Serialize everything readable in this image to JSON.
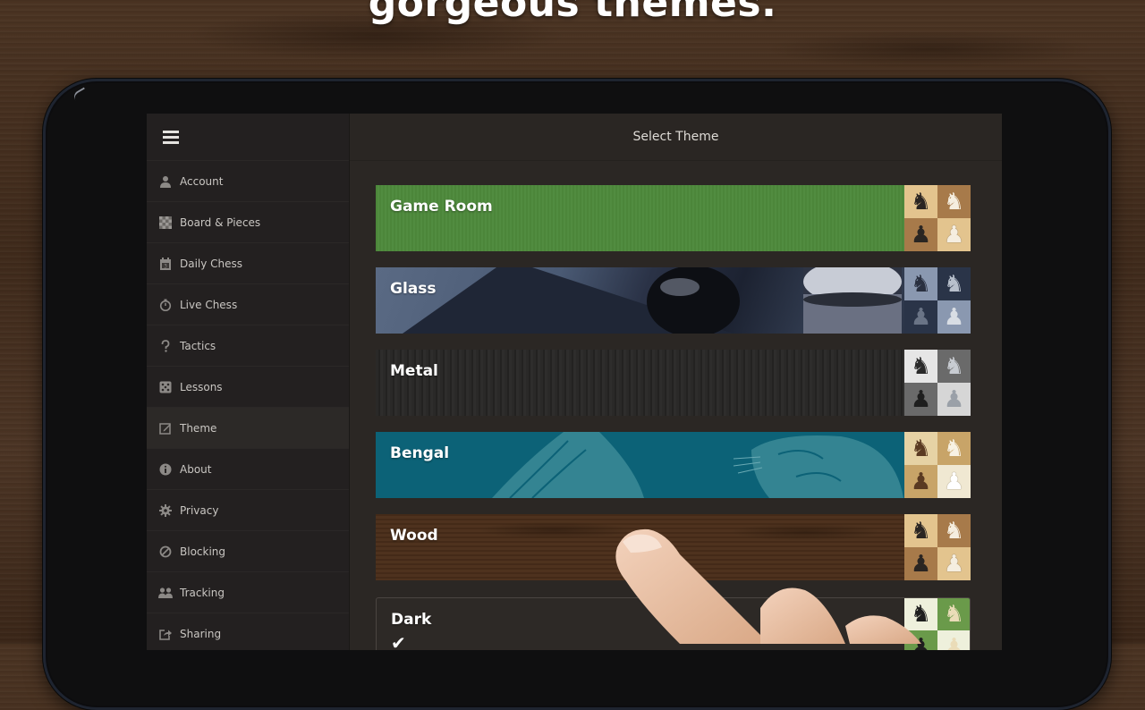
{
  "headline": "gorgeous themes.",
  "sidebar": {
    "menu_icon": "hamburger-menu-icon",
    "items": [
      {
        "label": "Account",
        "icon": "user-icon"
      },
      {
        "label": "Board & Pieces",
        "icon": "checkerboard-icon"
      },
      {
        "label": "Daily Chess",
        "icon": "calendar-icon"
      },
      {
        "label": "Live Chess",
        "icon": "stopwatch-icon"
      },
      {
        "label": "Tactics",
        "icon": "question-icon"
      },
      {
        "label": "Lessons",
        "icon": "dice-icon"
      },
      {
        "label": "Theme",
        "icon": "edit-icon"
      },
      {
        "label": "About",
        "icon": "info-icon"
      },
      {
        "label": "Privacy",
        "icon": "gear-icon"
      },
      {
        "label": "Blocking",
        "icon": "block-icon"
      },
      {
        "label": "Tracking",
        "icon": "users-icon"
      },
      {
        "label": "Sharing",
        "icon": "share-icon"
      }
    ],
    "active": "Theme"
  },
  "main": {
    "title": "Select Theme",
    "themes": [
      {
        "name": "Game Room",
        "color": "#4e8a3c",
        "selected": false
      },
      {
        "name": "Glass",
        "color": "#4a5a74",
        "selected": false
      },
      {
        "name": "Metal",
        "color": "#2a2827",
        "selected": false
      },
      {
        "name": "Bengal",
        "color": "#0c6277",
        "selected": false
      },
      {
        "name": "Wood",
        "color": "#4a2e1a",
        "selected": false
      },
      {
        "name": "Dark",
        "color": "#2a2623",
        "selected": true,
        "check": "✔"
      }
    ],
    "pieces": {
      "knight_black": "♞",
      "knight_white": "♘",
      "pawn_black": "♟",
      "pawn_white": "♙"
    }
  }
}
